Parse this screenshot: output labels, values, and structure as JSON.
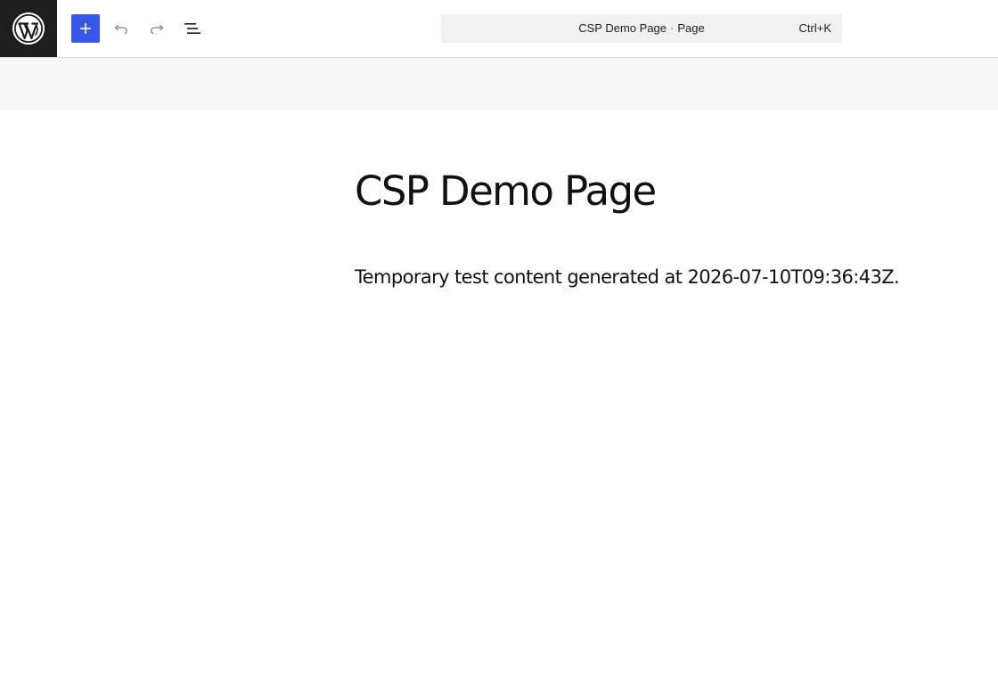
{
  "toolbar": {
    "logo_icon": "wordpress-logo-icon",
    "inserter_icon": "plus-icon",
    "undo_icon": "undo-icon",
    "redo_icon": "redo-icon",
    "list_view_icon": "list-view-icon",
    "accent_color": "#3858e9"
  },
  "command_bar": {
    "document_title": "CSP Demo Page",
    "separator": "·",
    "document_type": "Page",
    "shortcut": "Ctrl+K"
  },
  "editor": {
    "title": "CSP Demo Page",
    "paragraph": "Temporary test content generated at 2026-07-10T09:36:43Z."
  }
}
